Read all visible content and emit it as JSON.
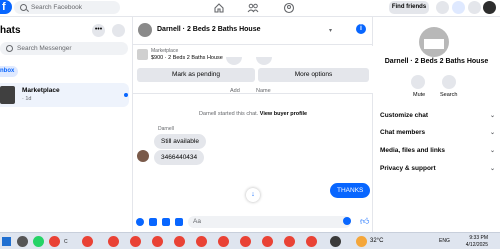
{
  "topbar": {
    "logo_letter": "f",
    "search_placeholder": "Search Facebook",
    "find_friends": "Find friends",
    "nav_icons": [
      "home-icon",
      "friends-icon",
      "groups-icon"
    ],
    "right_icons": [
      "grid-menu-icon",
      "messenger-icon",
      "notifications-icon",
      "profile-avatar"
    ]
  },
  "sidebar": {
    "title": "hats",
    "more_label": "•••",
    "search_placeholder": "Search Messenger",
    "filter_label": "nbox",
    "conversation": {
      "title": "Marketplace",
      "time": "· 1d"
    }
  },
  "chat": {
    "header_title": "Darnell · 2 Beds 2 Baths House",
    "info_label": "i",
    "marketplace": {
      "label": "Marketplace",
      "listing": "$900 · 2 Beds 2 Baths House",
      "mark_pending": "Mark as pending",
      "more_options": "More options"
    },
    "quick_actions": [
      "Add",
      "Name"
    ],
    "system_message_prefix": "Darnell started this chat.",
    "system_message_link": "View buyer profile",
    "sender_name": "Darnell",
    "messages_received": [
      "Still available",
      "3466440434"
    ],
    "message_sent": "THANKS",
    "composer_placeholder": "Aa"
  },
  "info_panel": {
    "title": "Darnell · 2 Beds 2 Baths House",
    "mute_label": "Mute",
    "search_label": "Search",
    "sections": [
      "Customize chat",
      "Chat members",
      "Media, files and links",
      "Privacy & support"
    ]
  },
  "taskbar": {
    "temperature": "32°C",
    "language": "ENG",
    "time": "9:33 PM",
    "date": "4/12/2025",
    "app_label": "C"
  },
  "colors": {
    "accent": "#0866ff",
    "background": "#f0f2f5",
    "bubble_gray": "#e4e6eb"
  }
}
